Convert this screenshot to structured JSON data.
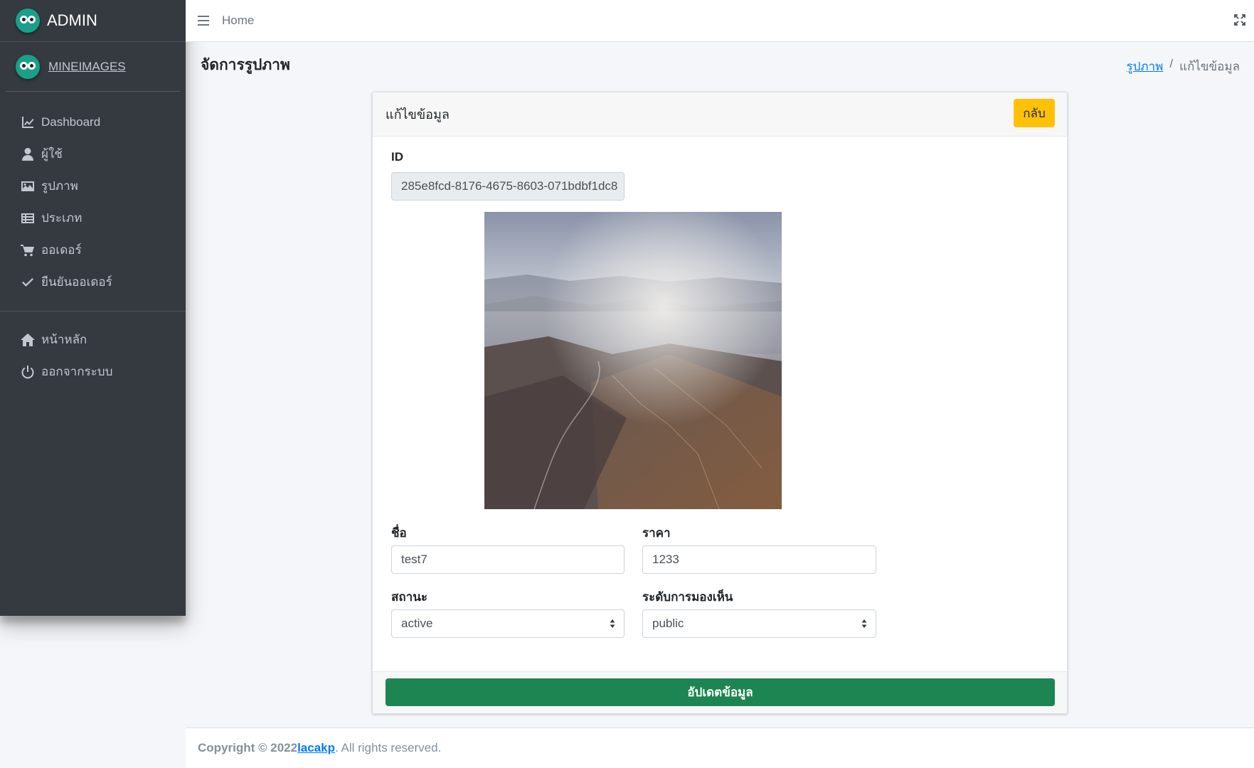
{
  "brand": {
    "title": "ADMIN",
    "icon": "owl-logo-icon"
  },
  "user": {
    "name": "MINEIMAGES"
  },
  "sidebar": {
    "items": [
      {
        "label": "Dashboard",
        "icon": "chart-line-icon"
      },
      {
        "label": "ผู้ใช้",
        "icon": "user-icon"
      },
      {
        "label": "รูปภาพ",
        "icon": "image-icon"
      },
      {
        "label": "ประเภท",
        "icon": "list-icon"
      },
      {
        "label": "ออเดอร์",
        "icon": "cart-icon"
      },
      {
        "label": "ยืนยันออเดอร์",
        "icon": "check-icon"
      }
    ],
    "secondary_items": [
      {
        "label": "หน้าหลัก",
        "icon": "home-icon"
      },
      {
        "label": "ออกจากระบบ",
        "icon": "power-icon"
      }
    ]
  },
  "topbar": {
    "home_label": "Home"
  },
  "page": {
    "title": "จัดการรูปภาพ"
  },
  "breadcrumb": {
    "link": "รูปภาพ",
    "separator": "/",
    "current": "แก้ไขข้อมูล"
  },
  "card": {
    "title": "แก้ไขข้อมูล",
    "back_button": "กลับ",
    "id_label": "ID",
    "id_value": "285e8fcd-8176-4675-8603-071bdbf1dc8",
    "name_label": "ชื่อ",
    "name_value": "test7",
    "price_label": "ราคา",
    "price_value": "1233",
    "status_label": "สถานะ",
    "status_value": "active",
    "visibility_label": "ระดับการมองเห็น",
    "visibility_value": "public",
    "update_button": "อัปเดตข้อมูล"
  },
  "footer": {
    "copyright": "Copyright © 2022",
    "author": "lacakp",
    "suffix": ". All rights reserved."
  },
  "colors": {
    "sidebar_bg": "#343a40",
    "accent_warning": "#ffc107",
    "success": "#1c8552",
    "link": "#007bff"
  }
}
